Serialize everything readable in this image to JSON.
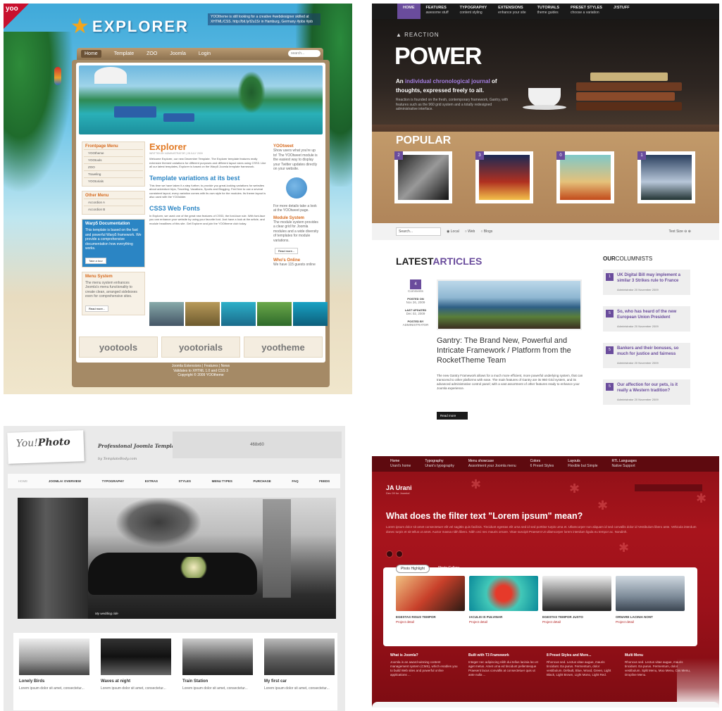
{
  "explorer": {
    "badge": "yoo",
    "logo": "EXPLORER",
    "ad_text": "YOOtheme is still looking for a creative #webdesigner skilled at XHTML/CSS. http://bit.ly/t2u1Sr in Hamburg, Germany #jobs #job",
    "nav": [
      "Home",
      "Template",
      "ZOO",
      "Joomla",
      "Login"
    ],
    "search_placeholder": "search...",
    "frontpage_menu": {
      "title": "Frontpage Menu",
      "items": [
        "YOOtheme",
        "YOOtools",
        "ZOO",
        "Traveling",
        "YOOtorials"
      ]
    },
    "other_menu": {
      "title": "Other Menu",
      "items": [
        "Accordion A",
        "Accordion B"
      ]
    },
    "warp": {
      "title": "Warp5 Documentation",
      "text": "This template is based on the fast and powerful Warp5 framework. We provide a comprehensive documentation how everything works.",
      "button": "Take a tour"
    },
    "menu_system": {
      "title": "Menu System",
      "text": "The menu system enhances Joomla's menu functionality to create clean, arranged sideboxes even for comprehensive sites.",
      "button": "Read more..."
    },
    "article": {
      "title": "Explorer",
      "meta": "WRITTEN BY ADMINISTRATOR | 28 JULY 2009",
      "intro": "Welcome Explorer, our new December Template. The Explorer template features really extensive themed variations for different purposes and different layout sizes using CSS3. Like all our latest templates, Explorer is based on the Warp5 Joomla template framework.",
      "h2": "Template variations at its best",
      "p2": "This time we have taken it a step further, to provide you great-looking variations for websites about adventure trips, Traveling, Vacations, Sports and Blogging. Feel free to use a several consistent layout, every variation comes with its own style for the modules. Its theme layout is also used with the YOOslider.",
      "h3": "CSS3 Web Fonts",
      "p3": "In Explorer, we used one of the great new features of CSS3, the font-face rule. With font-face you can enhance your website by using your favorite font. Just have a look at the article, and module headlines of this site. Get Explorer and join the YOOtheme club today."
    },
    "right": {
      "yootweet": "YOOtweet",
      "tweet_text": "Show users what you're up to! The YOOtweet module is the easiest way to display your Twitter updates directly on your website.",
      "tweet_more": "For more details take a look at the YOOtweet page.",
      "module_system": "Module System",
      "module_text": "The module system provides a clear grid for Joomla modules and a wide diversity of templates for module variations.",
      "module_button": "Read more...",
      "whos_online": "Who's Online",
      "online_text": "We have 115 guests online"
    },
    "footer_logos": [
      "yootools",
      "yootorials",
      "yootheme"
    ],
    "footer_links": "Joomla Extensions  |  Features  |  News",
    "footer_valid": "Validates to XHTML 1.0 and CSS 3",
    "footer_copy": "Copyright © 2009 YOOtheme"
  },
  "reaction": {
    "nav": [
      {
        "label": "HOME",
        "sub": ""
      },
      {
        "label": "FEATURES",
        "sub": "awesome stuff"
      },
      {
        "label": "TYPOGRAPHY",
        "sub": "content styling"
      },
      {
        "label": "EXTENSIONS",
        "sub": "enhance your site"
      },
      {
        "label": "TUTORIALS",
        "sub": "theme guides"
      },
      {
        "label": "PRESET STYLES",
        "sub": "choose a variation"
      },
      {
        "label": "J!STUFF",
        "sub": ""
      }
    ],
    "brand": "REACTION",
    "power": "POWER",
    "tag_1": "An ",
    "tag_hl": "individual chronological journal",
    "tag_2": " of thoughts, expressed freely to all.",
    "desc": "Reaction is founded on the fresh, contemporary framework, Gantry, with features such as the 960 grid system and a totally redesigned administrative interface.",
    "popular": "POPULAR",
    "pop_numbers": [
      "2",
      "3",
      "0",
      "1"
    ],
    "search_value": "Search...",
    "radios": [
      "Local",
      "Web",
      "Blogs"
    ],
    "text_size": "Text Size",
    "latest_1": "LATEST",
    "latest_2": "ARTICLES",
    "columnists_1": "OUR",
    "columnists_2": "COLUMNISTS",
    "comments_count": "4",
    "comments_label": "Comments",
    "posted_label": "POSTED ON",
    "posted": "Nov 26, 2009",
    "updated_label": "LAST UPDATED",
    "updated": "Dec 02, 2009",
    "by_label": "POSTED BY",
    "by": "ADMINISTRATOR",
    "headline": "Gantry: The Brand New, Powerful and Intricate Framework / Platform from the RocketTheme Team",
    "body": "The new Gantry Framework allows for a much more efficient, more powerful underlying system, that can transcend to other platforms with ease. The main features of Gantry are its 960 Grid system, and its advanced administrative control panel; with a vast assortment of other features ready to enhance your Joomla experience.",
    "read_more": "Read more",
    "columnists": [
      {
        "n": "1",
        "t": "UK Digital Bill may implement a similar 3 Strikes rule to France",
        "a": "Administrator  20 November 2009"
      },
      {
        "n": "5",
        "t": "So, who has heard of the new European Union President",
        "a": "Administrator  20 November 2009"
      },
      {
        "n": "5",
        "t": "Bankers and their bonuses, so much for justice and fairness",
        "a": "Administrator  20 November 2009"
      },
      {
        "n": "5",
        "t": "Our affection for our pets, is it really a Western tradition?",
        "a": "Administrator  20 November 2009"
      }
    ]
  },
  "youphoto": {
    "logo_a": "You!",
    "logo_b": "Photo",
    "tagline": "Professional Joomla Template",
    "tagline_by": "by TemplateBody.com",
    "banner": "468x60",
    "nav": [
      "HOME",
      "JOOMLA! OVERVIEW",
      "TYPOGRAPHY",
      "EXTRAS",
      "STYLES",
      "MENU TYPES",
      "PURCHASE",
      "FAQ",
      "FEEDS"
    ],
    "caption": "My wedding ride",
    "items": [
      {
        "title": "Lonely Birds",
        "text": "Lorem ipsum dolor sit amet, consectetur..."
      },
      {
        "title": "Waves at night",
        "text": "Lorem ipsum dolor sit amet, consectetur..."
      },
      {
        "title": "Train Station",
        "text": "Lorem ipsum dolor sit amet, consectetur..."
      },
      {
        "title": "My first car",
        "text": "Lorem ipsum dolor sit amet, consectetur..."
      }
    ]
  },
  "urani": {
    "nav": [
      {
        "label": "Home",
        "sub": "Urani's home"
      },
      {
        "label": "Typography",
        "sub": "Urani's typography"
      },
      {
        "label": "Menu showcase",
        "sub": "Assortment your Joomla menu"
      },
      {
        "label": "Colors",
        "sub": "6 Preset Styles"
      },
      {
        "label": "Layouts",
        "sub": "Flexible but Simple"
      },
      {
        "label": "RTL Languages",
        "sub": "Native Support"
      }
    ],
    "brand": "JA Urani",
    "brand_sub": "Dec 09 for Joomla!",
    "title": "What does the filter text \"Lorem ipsum\" mean?",
    "intro": "Lorem ipsum dolor sit amet consectetuer elit vel sagittis quis facilisis. Tincidunt egestas elit urna sed id sed porttitor turpis urna et. Ullamcorper non aliquam id sed convallis dolor id Vestibulum libero ante. Vehicula interdum donec turpis et sit tellus ut amet. Auctor massa nibh libero. Nibh orci nec mauris ornare. Vitae suscipit Praesent Ut ullamcorper lorem interdum ligula eu tempor ac. Nondinh.",
    "tabs": [
      "Photo Highlight",
      "Photo Gallery"
    ],
    "gallery": [
      {
        "title": "EGESTAS RISUS TEMPOR",
        "link": "Project detail"
      },
      {
        "title": "IACULIS IS PULVINAR",
        "link": "Project detail"
      },
      {
        "title": "EGESTAS TEMPOR JUSTO",
        "link": "Project detail"
      },
      {
        "title": "ORNARE LACINIA NONT",
        "link": "Project detail"
      }
    ],
    "cols": [
      {
        "title": "What is Joomla?",
        "text": "Joomla is an award-winning content management system (CMS), which enables you to build Web sites and powerful online applications ..."
      },
      {
        "title": "Built with T3 Framework",
        "text": "Integer nec adipiscing nibh dui tellus lacinia leo et aget metus. Amet urna ed tincidunt pellentesque Praesent lacus convallis at consectetuer quis ut ante nulla ..."
      },
      {
        "title": "8 Preset Styles and More...",
        "text": "Rhoncus sed. Lectus vitae augue, mauris tincidunt. Ea purus. Fermentum, dolor vestibulum. Default, Blue, Wood, Green, Light Black, Light Brown, Light Mono, Light Red."
      },
      {
        "title": "Multi Menu",
        "text": "Rhoncus sed. Lectus vitae augue, mauris tincidunt. Ea purus. Fermentum, dolor vestibulum. Split Menu, Moo Menu, Css Menu, Dropline Menu."
      }
    ]
  }
}
